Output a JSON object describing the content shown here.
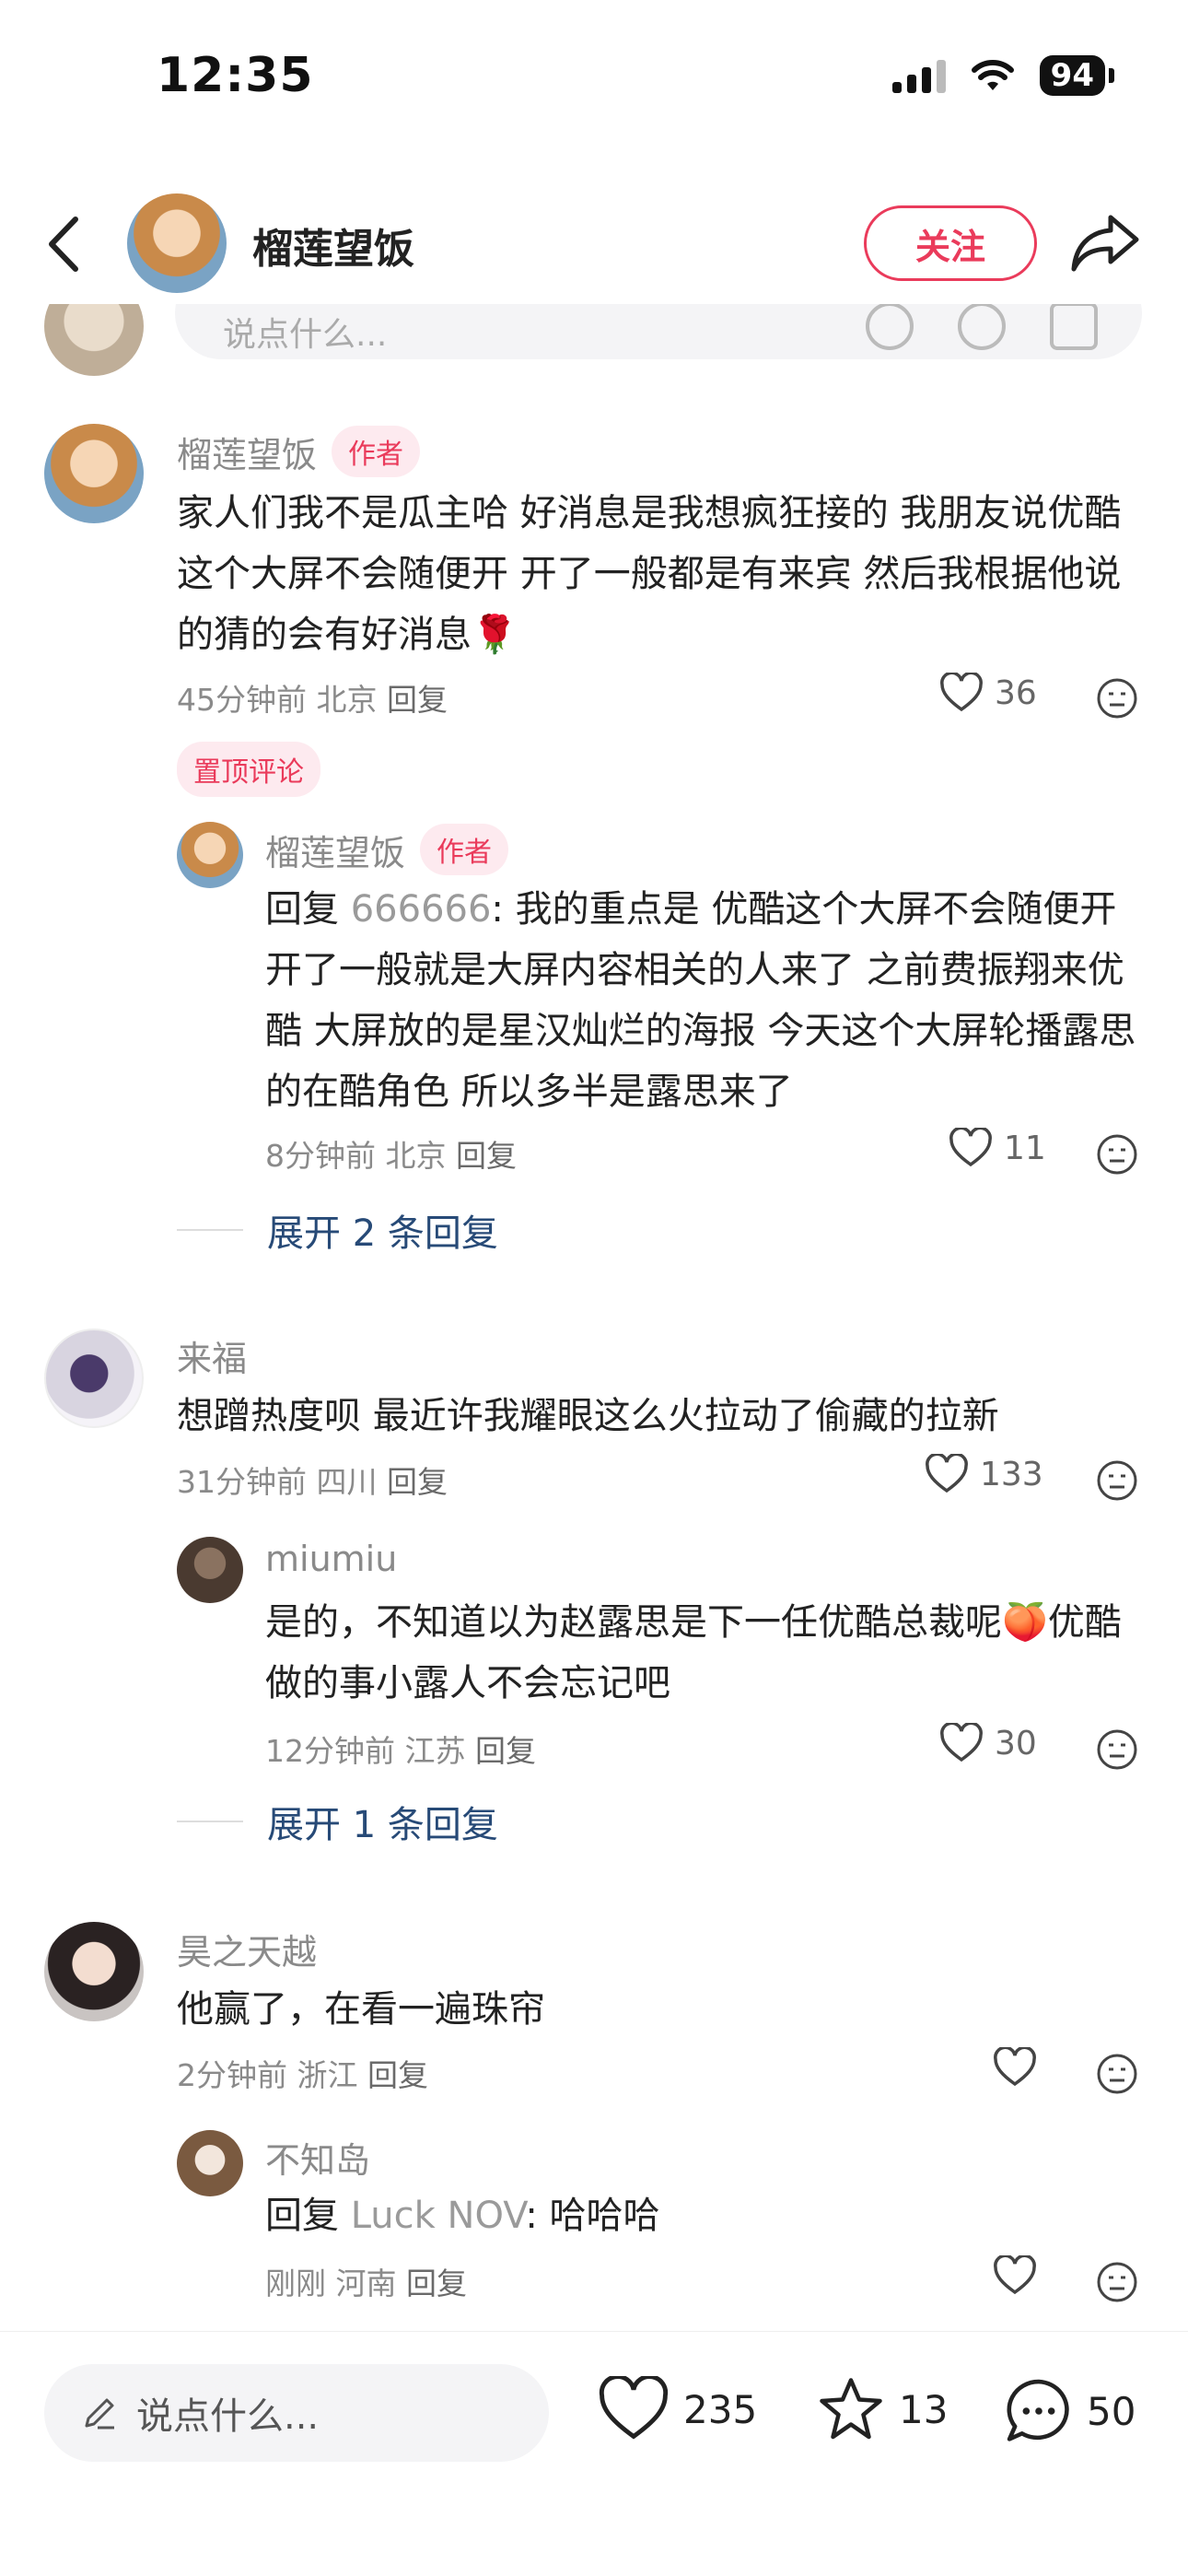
{
  "status_bar": {
    "time": "12:35",
    "battery": "94"
  },
  "header": {
    "name": "榴莲望饭",
    "follow_label": "关注"
  },
  "partial_input": {
    "placeholder": "说点什么..."
  },
  "comments": [
    {
      "name": "榴莲望饭",
      "tag": "作者",
      "text": "家人们我不是瓜主哈 好消息是我想疯狂接的 我朋友说优酷这个大屏不会随便开 开了一般都是有来宾 然后我根据他说的猜的会有好消息🌹",
      "time": "45分钟前",
      "location": "北京",
      "reply_label": "回复",
      "likes": "36",
      "pinned": "置顶评论",
      "replies": [
        {
          "name": "榴莲望饭",
          "tag": "作者",
          "reply_prefix": "回复",
          "reply_to": "666666",
          "text": ": 我的重点是 优酷这个大屏不会随便开 开了一般就是大屏内容相关的人来了 之前费振翔来优酷 大屏放的是星汉灿烂的海报 今天这个大屏轮播露思的在酷角色 所以多半是露思来了",
          "time": "8分钟前",
          "location": "北京",
          "reply_label": "回复",
          "likes": "11"
        }
      ],
      "expand": "展开 2 条回复"
    },
    {
      "name": "来福",
      "text": "想蹭热度呗 最近许我耀眼这么火拉动了偷藏的拉新",
      "time": "31分钟前",
      "location": "四川",
      "reply_label": "回复",
      "likes": "133",
      "replies": [
        {
          "name": "miumiu",
          "text": "是的，不知道以为赵露思是下一任优酷总裁呢🍑优酷做的事小露人不会忘记吧",
          "time": "12分钟前",
          "location": "江苏",
          "reply_label": "回复",
          "likes": "30"
        }
      ],
      "expand": "展开 1 条回复"
    },
    {
      "name": "昊之天越",
      "text": "他赢了，在看一遍珠帘",
      "time": "2分钟前",
      "location": "浙江",
      "reply_label": "回复",
      "likes": "",
      "replies": [
        {
          "name": "不知岛",
          "reply_prefix": "回复",
          "reply_to": "Luck NOV",
          "text": ": 哈哈哈",
          "time": "刚刚",
          "location": "河南",
          "reply_label": "回复",
          "likes": ""
        }
      ]
    }
  ],
  "bottom_bar": {
    "placeholder": "说点什么...",
    "likes": "235",
    "stars": "13",
    "comments": "50"
  },
  "colors": {
    "accent": "#ea3b5b",
    "link": "#274a77"
  }
}
